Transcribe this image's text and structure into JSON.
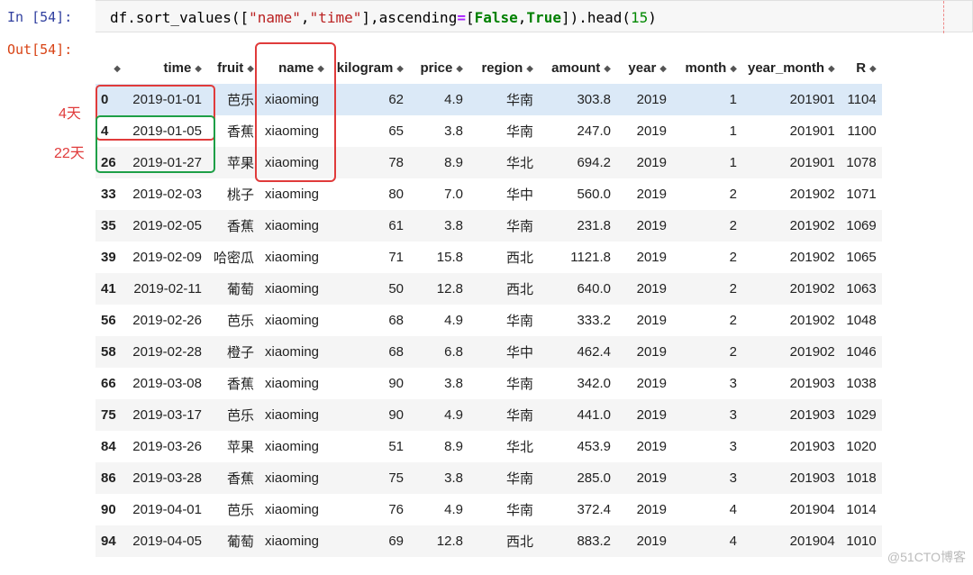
{
  "input_prompt": "In [54]:",
  "output_prompt": "Out[54]:",
  "code": {
    "p1": "df.sort_values([",
    "s1": "\"name\"",
    "p2": ",",
    "s2": "\"time\"",
    "p3": "],ascending",
    "eq": "=",
    "p4": "[",
    "k1": "False",
    "p5": ",",
    "k2": "True",
    "p6": "]).head(",
    "n": "15",
    "p7": ")"
  },
  "table": {
    "columns": [
      "time",
      "fruit",
      "name",
      "kilogram",
      "price",
      "region",
      "amount",
      "year",
      "month",
      "year_month",
      "R"
    ],
    "rows": [
      [
        "0",
        "2019-01-01",
        "芭乐",
        "xiaoming",
        "62",
        "4.9",
        "华南",
        "303.8",
        "2019",
        "1",
        "201901",
        "1104"
      ],
      [
        "4",
        "2019-01-05",
        "香蕉",
        "xiaoming",
        "65",
        "3.8",
        "华南",
        "247.0",
        "2019",
        "1",
        "201901",
        "1100"
      ],
      [
        "26",
        "2019-01-27",
        "苹果",
        "xiaoming",
        "78",
        "8.9",
        "华北",
        "694.2",
        "2019",
        "1",
        "201901",
        "1078"
      ],
      [
        "33",
        "2019-02-03",
        "桃子",
        "xiaoming",
        "80",
        "7.0",
        "华中",
        "560.0",
        "2019",
        "2",
        "201902",
        "1071"
      ],
      [
        "35",
        "2019-02-05",
        "香蕉",
        "xiaoming",
        "61",
        "3.8",
        "华南",
        "231.8",
        "2019",
        "2",
        "201902",
        "1069"
      ],
      [
        "39",
        "2019-02-09",
        "哈密瓜",
        "xiaoming",
        "71",
        "15.8",
        "西北",
        "1121.8",
        "2019",
        "2",
        "201902",
        "1065"
      ],
      [
        "41",
        "2019-02-11",
        "葡萄",
        "xiaoming",
        "50",
        "12.8",
        "西北",
        "640.0",
        "2019",
        "2",
        "201902",
        "1063"
      ],
      [
        "56",
        "2019-02-26",
        "芭乐",
        "xiaoming",
        "68",
        "4.9",
        "华南",
        "333.2",
        "2019",
        "2",
        "201902",
        "1048"
      ],
      [
        "58",
        "2019-02-28",
        "橙子",
        "xiaoming",
        "68",
        "6.8",
        "华中",
        "462.4",
        "2019",
        "2",
        "201902",
        "1046"
      ],
      [
        "66",
        "2019-03-08",
        "香蕉",
        "xiaoming",
        "90",
        "3.8",
        "华南",
        "342.0",
        "2019",
        "3",
        "201903",
        "1038"
      ],
      [
        "75",
        "2019-03-17",
        "芭乐",
        "xiaoming",
        "90",
        "4.9",
        "华南",
        "441.0",
        "2019",
        "3",
        "201903",
        "1029"
      ],
      [
        "84",
        "2019-03-26",
        "苹果",
        "xiaoming",
        "51",
        "8.9",
        "华北",
        "453.9",
        "2019",
        "3",
        "201903",
        "1020"
      ],
      [
        "86",
        "2019-03-28",
        "香蕉",
        "xiaoming",
        "75",
        "3.8",
        "华南",
        "285.0",
        "2019",
        "3",
        "201903",
        "1018"
      ],
      [
        "90",
        "2019-04-01",
        "芭乐",
        "xiaoming",
        "76",
        "4.9",
        "华南",
        "372.4",
        "2019",
        "4",
        "201904",
        "1014"
      ],
      [
        "94",
        "2019-04-05",
        "葡萄",
        "xiaoming",
        "69",
        "12.8",
        "西北",
        "883.2",
        "2019",
        "4",
        "201904",
        "1010"
      ]
    ]
  },
  "annotations": {
    "gap1": "4天",
    "gap2": "22天",
    "box_red_color": "#e03b3b",
    "box_green_color": "#1e9f47"
  },
  "sort_icon": "sort-arrows-icon",
  "watermark": "@51CTO博客"
}
